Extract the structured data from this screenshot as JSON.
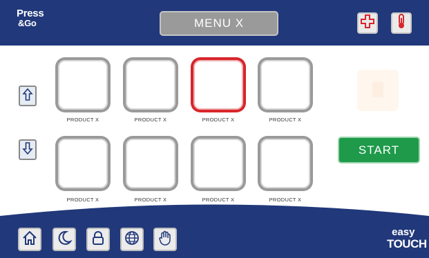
{
  "header": {
    "logo_line1": "Press",
    "logo_line2": "&Go",
    "menu_title": "MENU X",
    "buttons": [
      {
        "icon": "plus-icon"
      },
      {
        "icon": "thermometer-icon"
      }
    ]
  },
  "scroll": {
    "up_icon": "arrow-up-icon",
    "down_icon": "arrow-down-icon"
  },
  "products": [
    {
      "label": "PRODUCT X",
      "selected": false
    },
    {
      "label": "PRODUCT X",
      "selected": false
    },
    {
      "label": "PRODUCT X",
      "selected": true
    },
    {
      "label": "PRODUCT X",
      "selected": false
    },
    {
      "label": "PRODUCT X",
      "selected": false
    },
    {
      "label": "PRODUCT X",
      "selected": false
    },
    {
      "label": "PRODUCT X",
      "selected": false
    },
    {
      "label": "PRODUCT X",
      "selected": false
    }
  ],
  "start_label": "START",
  "footer": {
    "buttons": [
      {
        "icon": "home-icon"
      },
      {
        "icon": "moon-icon"
      },
      {
        "icon": "lock-icon"
      },
      {
        "icon": "globe-icon"
      },
      {
        "icon": "hand-icon"
      }
    ],
    "brand_line1": "easy",
    "brand_line2": "TOUCH"
  },
  "colors": {
    "bar": "#21387a",
    "selected": "#d8252a",
    "start": "#1e9a4a",
    "title_bg": "#9a9a9a"
  }
}
